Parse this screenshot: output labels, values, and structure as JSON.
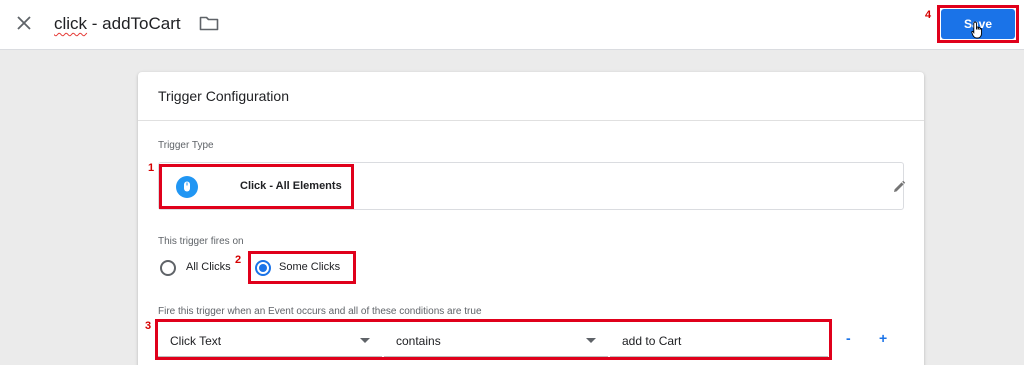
{
  "header": {
    "title_part1": "click",
    "title_part2": " - addToCart",
    "save_label": "Save"
  },
  "card": {
    "title": "Trigger Configuration",
    "trigger_type_label": "Trigger Type",
    "trigger_type_value": "Click - All Elements",
    "fires_on_label": "This trigger fires on",
    "fires_on_options": [
      {
        "label": "All Clicks",
        "selected": false
      },
      {
        "label": "Some Clicks",
        "selected": true
      }
    ],
    "conditions_label": "Fire this trigger when an Event occurs and all of these conditions are true",
    "condition": {
      "variable": "Click Text",
      "operator": "contains",
      "value": "add to Cart"
    },
    "remove_label": "-",
    "add_label": "+"
  },
  "annotations": {
    "markers": [
      "1",
      "2",
      "3",
      "4"
    ],
    "color": "#e0001b"
  },
  "colors": {
    "accent": "#1a73e8",
    "background": "#ebebeb"
  },
  "icons": [
    "close-icon",
    "folder-icon",
    "mouse-icon",
    "pencil-icon",
    "cursor-hand-icon",
    "dropdown-arrow-icon"
  ]
}
